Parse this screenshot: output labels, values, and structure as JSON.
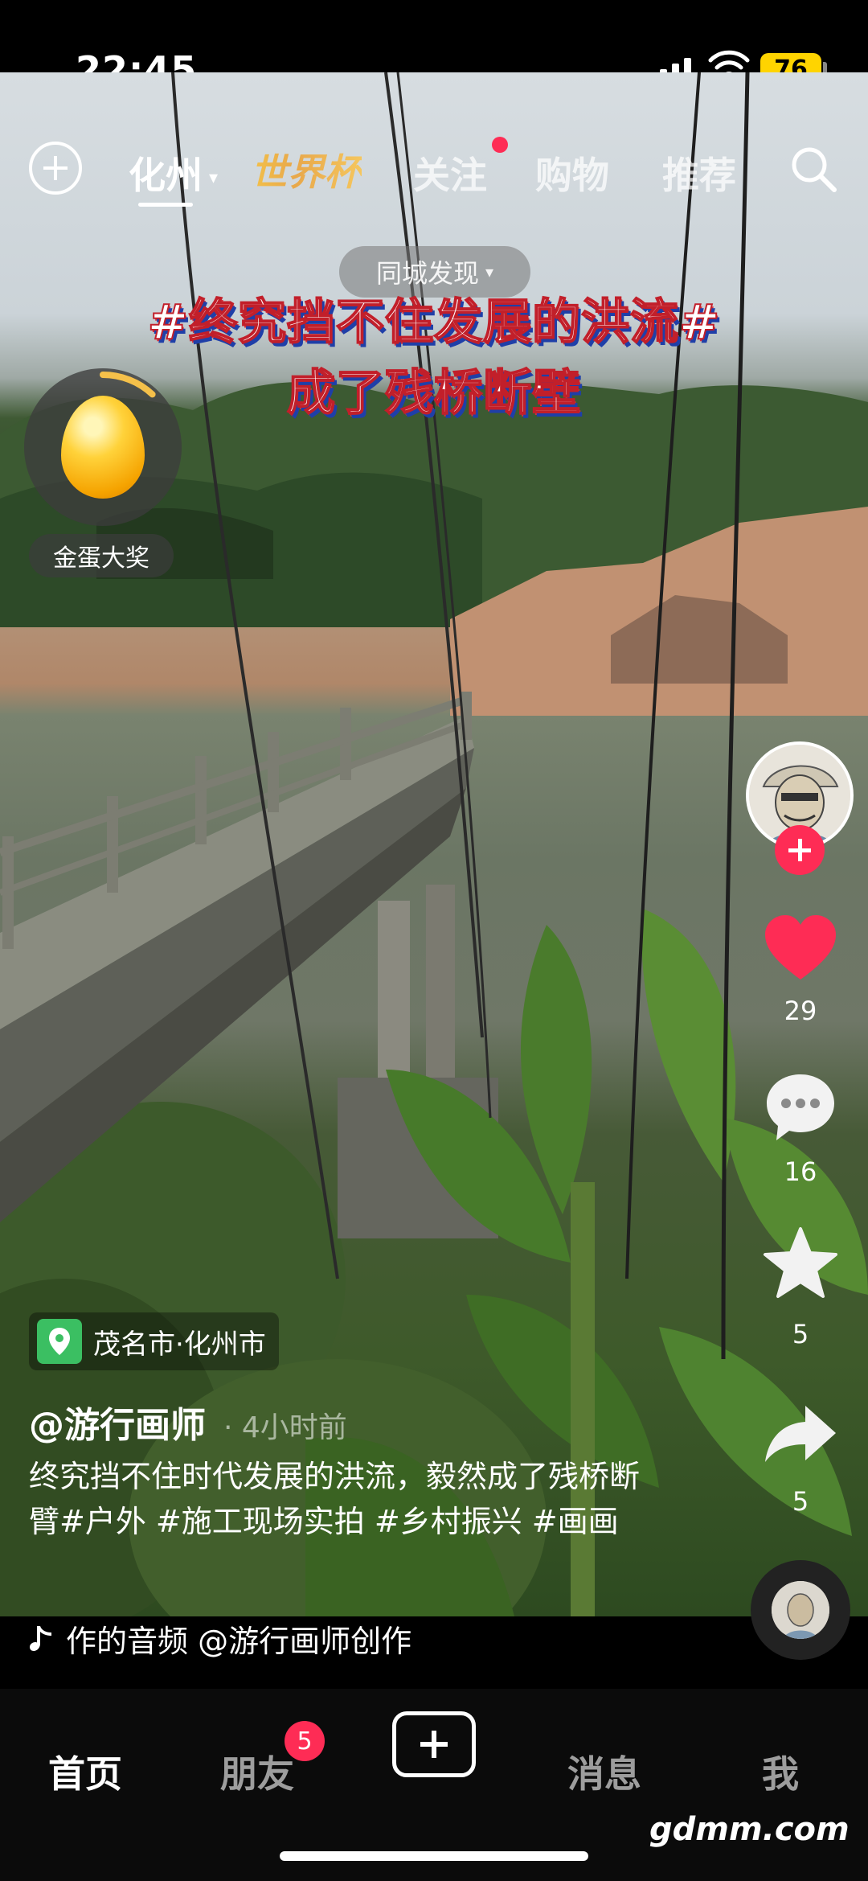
{
  "status_bar": {
    "time": "22:45",
    "battery": "76"
  },
  "top_nav": {
    "tabs": [
      {
        "label": "化州",
        "active": true
      },
      {
        "label": "世界杯"
      },
      {
        "label": "关注",
        "dot": true
      },
      {
        "label": "购物"
      },
      {
        "label": "推荐"
      }
    ]
  },
  "city_pill": {
    "label": "同城发现"
  },
  "headline": {
    "line1": "#终究挡不住发展的洪流#",
    "line2": "成了残桥断壁"
  },
  "egg": {
    "label": "金蛋大奖",
    "progress": 0.12
  },
  "rail": {
    "likes": "29",
    "comments": "16",
    "favorites": "5",
    "shares": "5"
  },
  "post": {
    "location": "茂名市·化州市",
    "author": "@游行画师",
    "time_ago": "· 4小时前",
    "caption": "终究挡不住时代发展的洪流，毅然成了残桥断臂#户外 #施工现场实拍 #乡村振兴 #画画",
    "music": "作的音频    @游行画师创作"
  },
  "tabbar": {
    "tabs": [
      {
        "label": "首页",
        "active": true
      },
      {
        "label": "朋友",
        "badge": "5"
      },
      {
        "label": "消息"
      },
      {
        "label": "我"
      }
    ]
  },
  "watermark": "gdmm.com",
  "colors": {
    "accent": "#fe2c55",
    "location_green": "#3bbf62",
    "battery": "#ffd400"
  }
}
